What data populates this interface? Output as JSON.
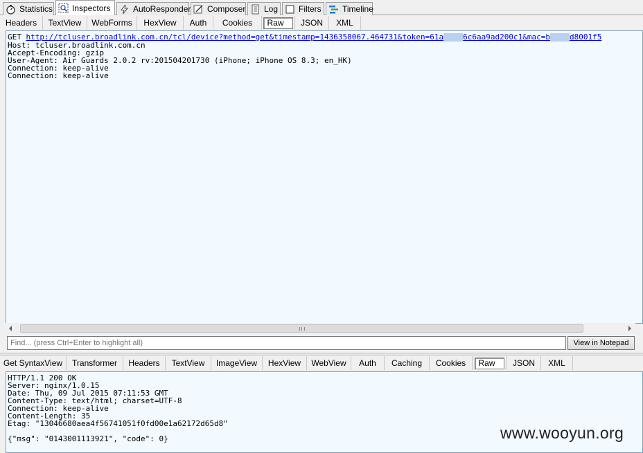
{
  "top_tabs": [
    {
      "label": "Statistics",
      "icon": "stopwatch-icon"
    },
    {
      "label": "Inspectors",
      "icon": "inspect-icon",
      "active": true
    },
    {
      "label": "AutoResponder",
      "icon": "lightning-icon"
    },
    {
      "label": "Composer",
      "icon": "compose-icon"
    },
    {
      "label": "Log",
      "icon": "log-icon"
    },
    {
      "label": "Filters",
      "icon": "checkbox-icon"
    },
    {
      "label": "Timeline",
      "icon": "timeline-icon"
    }
  ],
  "request_tabs": [
    "Headers",
    "TextView",
    "WebForms",
    "HexView",
    "Auth",
    "Cookies",
    "Raw",
    "JSON",
    "XML"
  ],
  "request_active_tab": "Raw",
  "request": {
    "method": "GET",
    "url_part1": "http://tcluser.broadlink.com.cn/tcl/device?method=get&timestamp=1436358067.464731&token=61a",
    "url_part2": "6c6aa9ad200c1&mac=b",
    "url_part3": "d8001f5",
    "lines": [
      "Host: tcluser.broadlink.com.cn",
      "Accept-Encoding: gzip",
      "User-Agent: Air Guards 2.0.2 rv:201504201730 (iPhone; iPhone OS 8.3; en_HK)",
      "Connection: keep-alive",
      "Connection: keep-alive"
    ]
  },
  "find": {
    "placeholder": "Find... (press Ctrl+Enter to highlight all)",
    "button": "View in Notepad"
  },
  "response_tabs": [
    "Get SyntaxView",
    "Transformer",
    "Headers",
    "TextView",
    "ImageView",
    "HexView",
    "WebView",
    "Auth",
    "Caching",
    "Cookies",
    "Raw",
    "JSON",
    "XML"
  ],
  "response_active_tab": "Raw",
  "response": {
    "lines": [
      "HTTP/1.1 200 OK",
      "Server: nginx/1.0.15",
      "Date: Thu, 09 Jul 2015 07:11:53 GMT",
      "Content-Type: text/html; charset=UTF-8",
      "Connection: keep-alive",
      "Content-Length: 35",
      "Etag: \"13046680aea4f56741051f0fd00e1a62172d65d8\""
    ],
    "body": "{\"msg\": \"0143001113921\", \"code\": 0}"
  },
  "watermark": "www.wooyun.org"
}
